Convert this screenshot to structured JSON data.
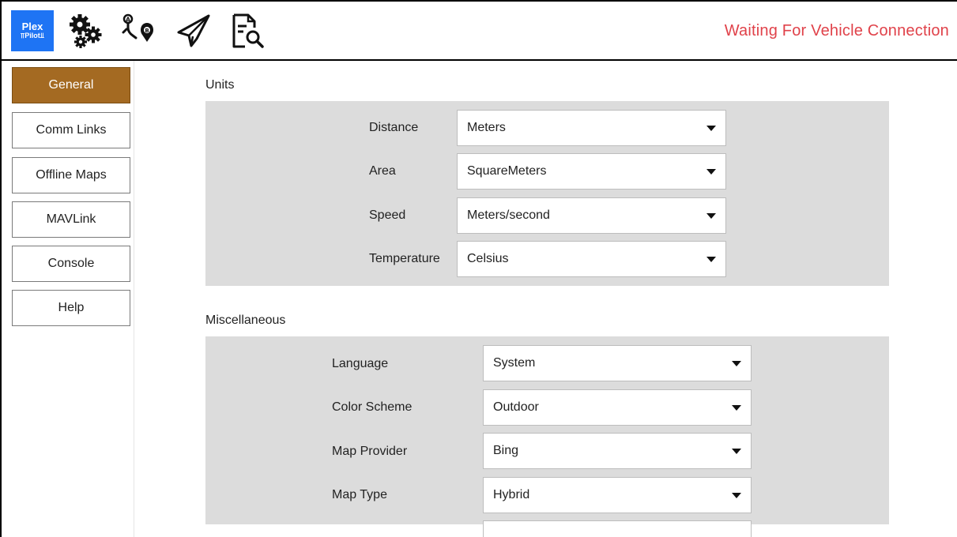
{
  "logo": {
    "line1": "Plex",
    "line2": "⫪Pilot⫫"
  },
  "toolbar": {
    "icons": [
      "gears-icon",
      "route-waypoints-icon",
      "paper-plane-icon",
      "document-search-icon"
    ],
    "status_text": "Waiting For Vehicle Connection",
    "status_color": "#e0424a"
  },
  "sidebar": {
    "items": [
      {
        "label": "General",
        "active": true
      },
      {
        "label": "Comm Links"
      },
      {
        "label": "Offline Maps"
      },
      {
        "label": "MAVLink"
      },
      {
        "label": "Console"
      },
      {
        "label": "Help"
      }
    ],
    "active_color": "#a46a22"
  },
  "units": {
    "title": "Units",
    "rows": [
      {
        "label": "Distance",
        "value": "Meters"
      },
      {
        "label": "Area",
        "value": "SquareMeters"
      },
      {
        "label": "Speed",
        "value": "Meters/second"
      },
      {
        "label": "Temperature",
        "value": "Celsius"
      }
    ]
  },
  "misc": {
    "title": "Miscellaneous",
    "rows": [
      {
        "label": "Language",
        "value": "System"
      },
      {
        "label": "Color Scheme",
        "value": "Outdoor"
      },
      {
        "label": "Map Provider",
        "value": "Bing"
      },
      {
        "label": "Map Type",
        "value": "Hybrid"
      },
      {
        "label": "",
        "value": ""
      }
    ]
  }
}
